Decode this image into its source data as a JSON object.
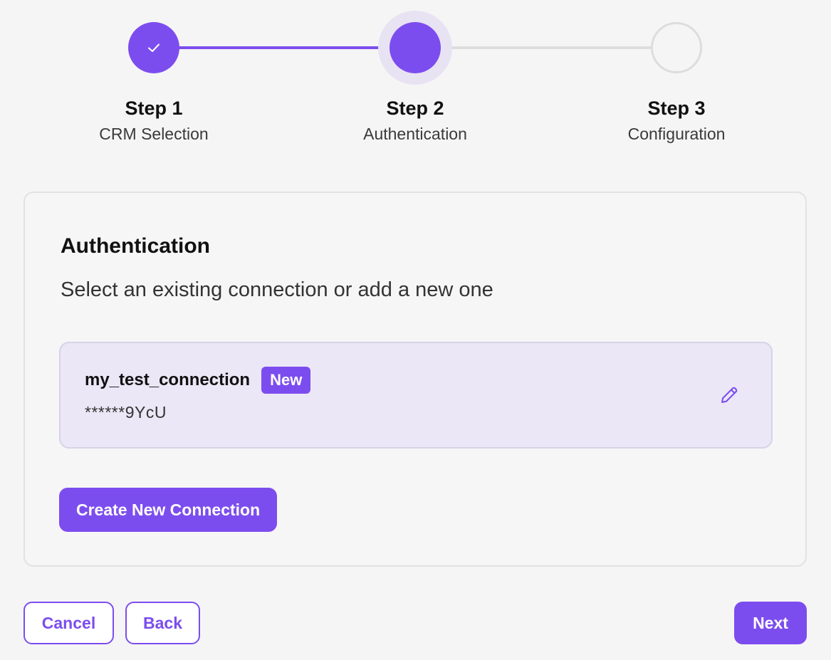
{
  "theme": {
    "accent": "#7c4dee",
    "accent_light": "#ebe7f6",
    "inactive": "#dddddd"
  },
  "stepper": {
    "steps": [
      {
        "title": "Step 1",
        "subtitle": "CRM Selection",
        "state": "completed",
        "icon": "check-icon"
      },
      {
        "title": "Step 2",
        "subtitle": "Authentication",
        "state": "active"
      },
      {
        "title": "Step 3",
        "subtitle": "Configuration",
        "state": "upcoming"
      }
    ]
  },
  "auth": {
    "title": "Authentication",
    "description": "Select an existing connection or add a new one",
    "connection": {
      "name": "my_test_connection",
      "badge": "New",
      "masked_key": "******9YcU",
      "edit_icon": "pencil-icon"
    },
    "create_label": "Create New Connection"
  },
  "footer": {
    "cancel_label": "Cancel",
    "back_label": "Back",
    "next_label": "Next"
  }
}
